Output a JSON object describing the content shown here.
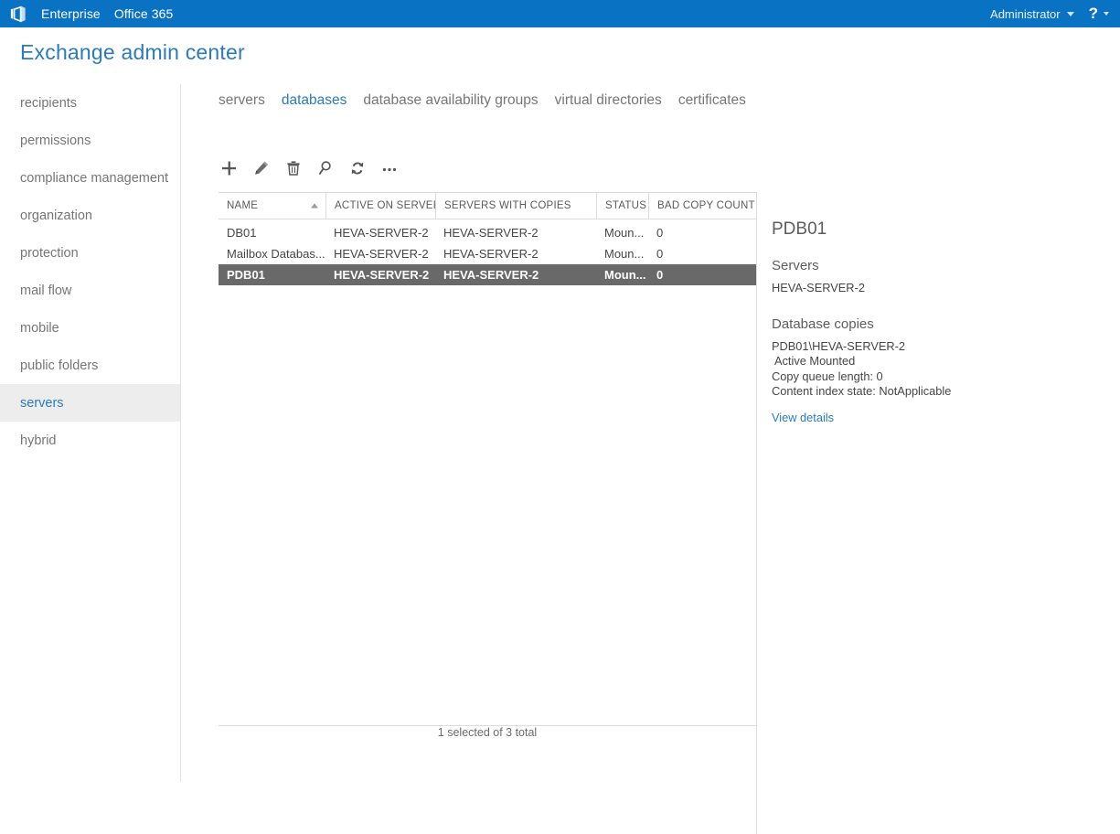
{
  "suite_bar": {
    "logo_icon": "office-logo-icon",
    "links": [
      "Enterprise",
      "Office 365"
    ],
    "user_label": "Administrator",
    "user_caret_icon": "chevron-down-icon",
    "help_label": "?",
    "help_caret_icon": "chevron-down-icon",
    "bg_color": "#0a72c3"
  },
  "page_title": "Exchange admin center",
  "sidebar": {
    "items": [
      {
        "label": "recipients",
        "selected": false
      },
      {
        "label": "permissions",
        "selected": false
      },
      {
        "label": "compliance management",
        "selected": false
      },
      {
        "label": "organization",
        "selected": false
      },
      {
        "label": "protection",
        "selected": false
      },
      {
        "label": "mail flow",
        "selected": false
      },
      {
        "label": "mobile",
        "selected": false
      },
      {
        "label": "public folders",
        "selected": false
      },
      {
        "label": "servers",
        "selected": true
      },
      {
        "label": "hybrid",
        "selected": false
      }
    ],
    "selected_bg": "#ededed",
    "selected_color": "#2a7ac0"
  },
  "tabs": [
    {
      "label": "servers",
      "active": false
    },
    {
      "label": "databases",
      "active": true
    },
    {
      "label": "database availability groups",
      "active": false
    },
    {
      "label": "virtual directories",
      "active": false
    },
    {
      "label": "certificates",
      "active": false
    }
  ],
  "toolbar": {
    "buttons": [
      {
        "name": "add-button",
        "icon": "plus-icon"
      },
      {
        "name": "edit-button",
        "icon": "pencil-icon"
      },
      {
        "name": "delete-button",
        "icon": "trash-icon"
      },
      {
        "name": "search-button",
        "icon": "magnifier-icon"
      },
      {
        "name": "refresh-button",
        "icon": "refresh-icon"
      },
      {
        "name": "more-button",
        "icon": "ellipsis-icon"
      }
    ]
  },
  "table": {
    "columns": [
      {
        "label": "NAME",
        "sorted": "asc",
        "sort_icon": "sort-ascending-icon"
      },
      {
        "label": "ACTIVE ON SERVER",
        "sorted": ""
      },
      {
        "label": "SERVERS WITH COPIES",
        "sorted": ""
      },
      {
        "label": "STATUS",
        "sorted": ""
      },
      {
        "label": "BAD COPY COUNT",
        "sorted": ""
      }
    ],
    "rows": [
      {
        "name": "DB01",
        "active_on_server": "HEVA-SERVER-2",
        "servers_with_copies": "HEVA-SERVER-2",
        "status": "Moun...",
        "bad_copy_count": "0",
        "selected": false
      },
      {
        "name": "Mailbox Databas...",
        "active_on_server": "HEVA-SERVER-2",
        "servers_with_copies": "HEVA-SERVER-2",
        "status": "Moun...",
        "bad_copy_count": "0",
        "selected": false
      },
      {
        "name": "PDB01",
        "active_on_server": "HEVA-SERVER-2",
        "servers_with_copies": "HEVA-SERVER-2",
        "status": "Moun...",
        "bad_copy_count": "0",
        "selected": true
      }
    ],
    "selected_row_bg": "#696969",
    "status_text": "1 selected of 3 total"
  },
  "details": {
    "title": "PDB01",
    "servers_heading": "Servers",
    "servers_value": "HEVA-SERVER-2",
    "copies_heading": "Database copies",
    "copy_name": "PDB01\\HEVA-SERVER-2",
    "copy_state": "Active Mounted",
    "copy_queue": "Copy queue length:  0",
    "index_state": "Content index state:  NotApplicable",
    "view_details_label": "View details"
  }
}
